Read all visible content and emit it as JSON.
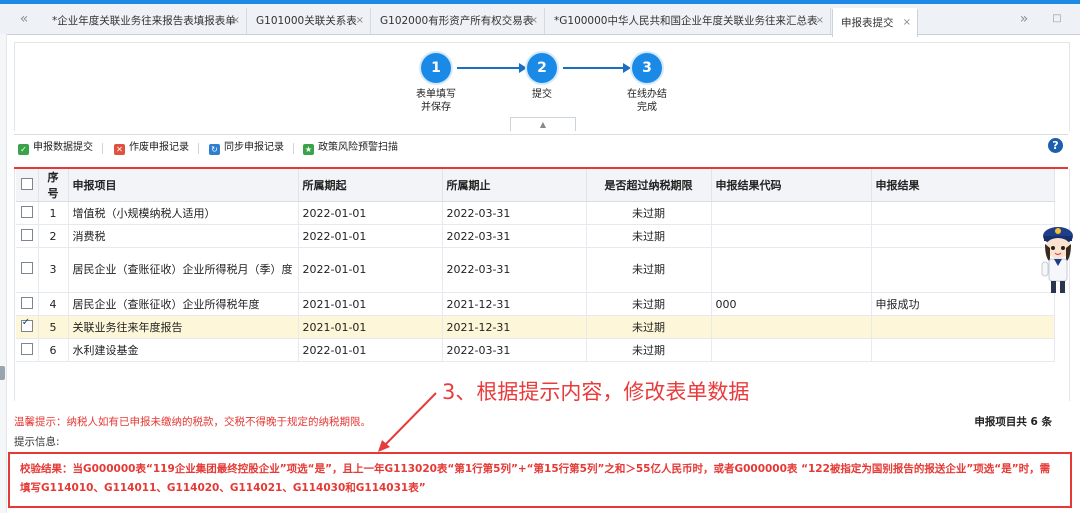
{
  "tabs": [
    {
      "label": "*企业年度关联业务往来报告表填报表单",
      "active": false
    },
    {
      "label": "G101000关联关系表",
      "active": false
    },
    {
      "label": "G102000有形资产所有权交易表",
      "active": false
    },
    {
      "label": "*G100000中华人民共和国企业年度关联业务往来汇总表",
      "active": false
    },
    {
      "label": "申报表提交",
      "active": true
    }
  ],
  "tab_close": "×",
  "tab_prev": "«",
  "tab_next": "»",
  "steps": [
    {
      "number": "1",
      "label_line1": "表单填写",
      "label_line2": "并保存"
    },
    {
      "number": "2",
      "label_line1": "提交",
      "label_line2": ""
    },
    {
      "number": "3",
      "label_line1": "在线办结",
      "label_line2": "完成"
    }
  ],
  "collapse_glyph": "▲",
  "toolbar": {
    "submit": "申报数据提交",
    "void": "作废申报记录",
    "sync": "同步申报记录",
    "scan": "政策风险预警扫描"
  },
  "help_glyph": "?",
  "table": {
    "headers": [
      "序号",
      "申报项目",
      "所属期起",
      "所属期止",
      "是否超过纳税期限",
      "申报结果代码",
      "申报结果"
    ],
    "rows": [
      {
        "no": "1",
        "item": "增值税（小规模纳税人适用）",
        "start": "2022-01-01",
        "end": "2022-03-31",
        "overdue": "未过期",
        "code": "",
        "result": "",
        "checked": false
      },
      {
        "no": "2",
        "item": "消费税",
        "start": "2022-01-01",
        "end": "2022-03-31",
        "overdue": "未过期",
        "code": "",
        "result": "",
        "checked": false
      },
      {
        "no": "3",
        "item": "居民企业（查账征收）企业所得税月（季）度",
        "start": "2022-01-01",
        "end": "2022-03-31",
        "overdue": "未过期",
        "code": "",
        "result": "",
        "checked": false
      },
      {
        "no": "4",
        "item": "居民企业（查账征收）企业所得税年度",
        "start": "2021-01-01",
        "end": "2021-12-31",
        "overdue": "未过期",
        "code": "000",
        "result": "申报成功",
        "checked": false
      },
      {
        "no": "5",
        "item": "关联业务往来年度报告",
        "start": "2021-01-01",
        "end": "2021-12-31",
        "overdue": "未过期",
        "code": "",
        "result": "",
        "checked": true
      },
      {
        "no": "6",
        "item": "水利建设基金",
        "start": "2022-01-01",
        "end": "2022-03-31",
        "overdue": "未过期",
        "code": "",
        "result": "",
        "checked": false
      }
    ]
  },
  "annotation": "3、根据提示内容，修改表单数据",
  "warm_tip": "温馨提示：纳税人如有已申报未缴纳的税款，交税不得晚于规定的纳税期限。",
  "total_count": "申报项目共 6 条",
  "hint_label": "提示信息:",
  "validation_result": "校验结果：当G000000表“119企业集团最终控股企业”项选“是”，且上一年G113020表“第1行第5列”+“第15行第5列”之和＞55亿人民币时，或者G000000表 “122被指定为国别报告的报送企业”项选“是”时，需填写G114010、G114011、G114020、G114021、G114030和G114031表”",
  "colors": {
    "accent": "#1a8ae6",
    "alert": "#e53935",
    "ok": "#1e9a2c",
    "selected_row": "#fdf6d8"
  }
}
